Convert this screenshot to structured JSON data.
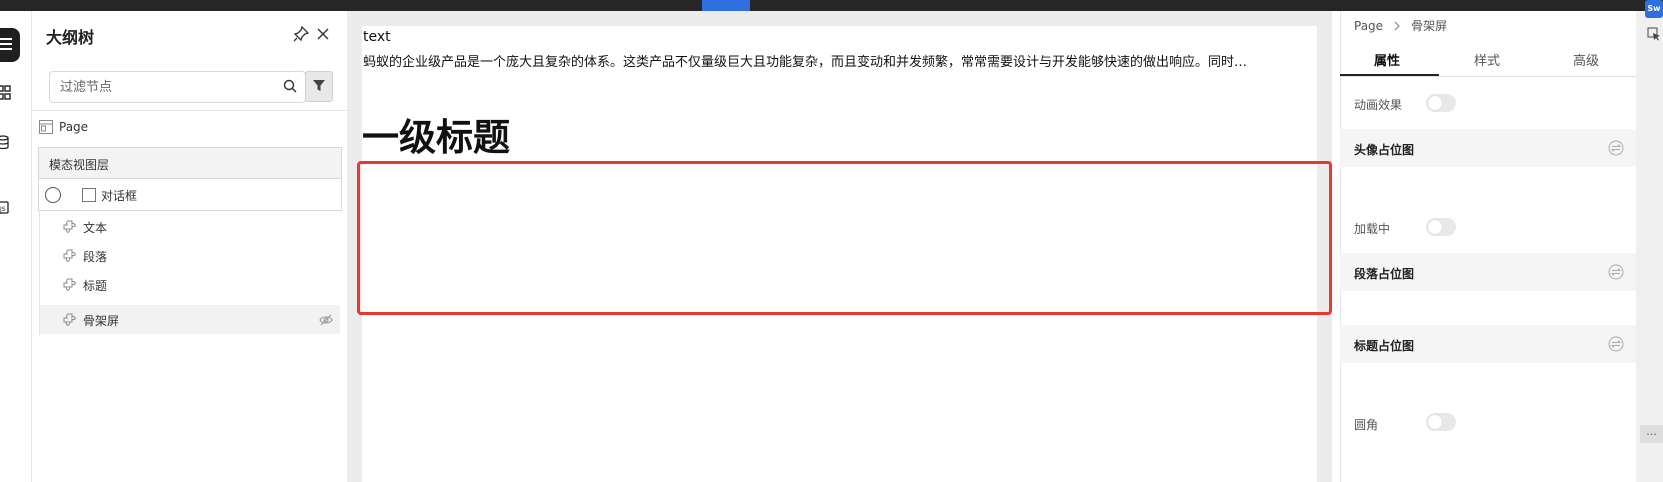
{
  "outline": {
    "title": "大纲树",
    "filter_placeholder": "过滤节点",
    "page_label": "Page",
    "modal_layer_label": "模态视图层",
    "dialog_label": "对话框",
    "nodes": [
      {
        "label": "文本"
      },
      {
        "label": "段落"
      },
      {
        "label": "标题"
      },
      {
        "label": "骨架屏"
      }
    ]
  },
  "canvas": {
    "text": "text",
    "paragraph": "蚂蚁的企业级产品是一个庞大且复杂的体系。这类产品不仅量级巨大且功能复杂，而且变动和并发频繁，常常需要设计与开发能够快速的做出响应。同时…",
    "heading": "一级标题"
  },
  "props": {
    "breadcrumb": [
      "Page",
      "骨架屏"
    ],
    "tabs": [
      "属性",
      "样式",
      "高级"
    ],
    "animation_label": "动画效果",
    "avatar_section": "头像占位图",
    "loading_label": "加载中",
    "paragraph_section": "段落占位图",
    "title_section": "标题占位图",
    "round_label": "圆角"
  },
  "edge": {
    "badge": "Sw",
    "more": "..."
  },
  "colors": {
    "topbar": "#262626",
    "accent": "#2f6fe0",
    "selection_outline": "#e8382f"
  }
}
